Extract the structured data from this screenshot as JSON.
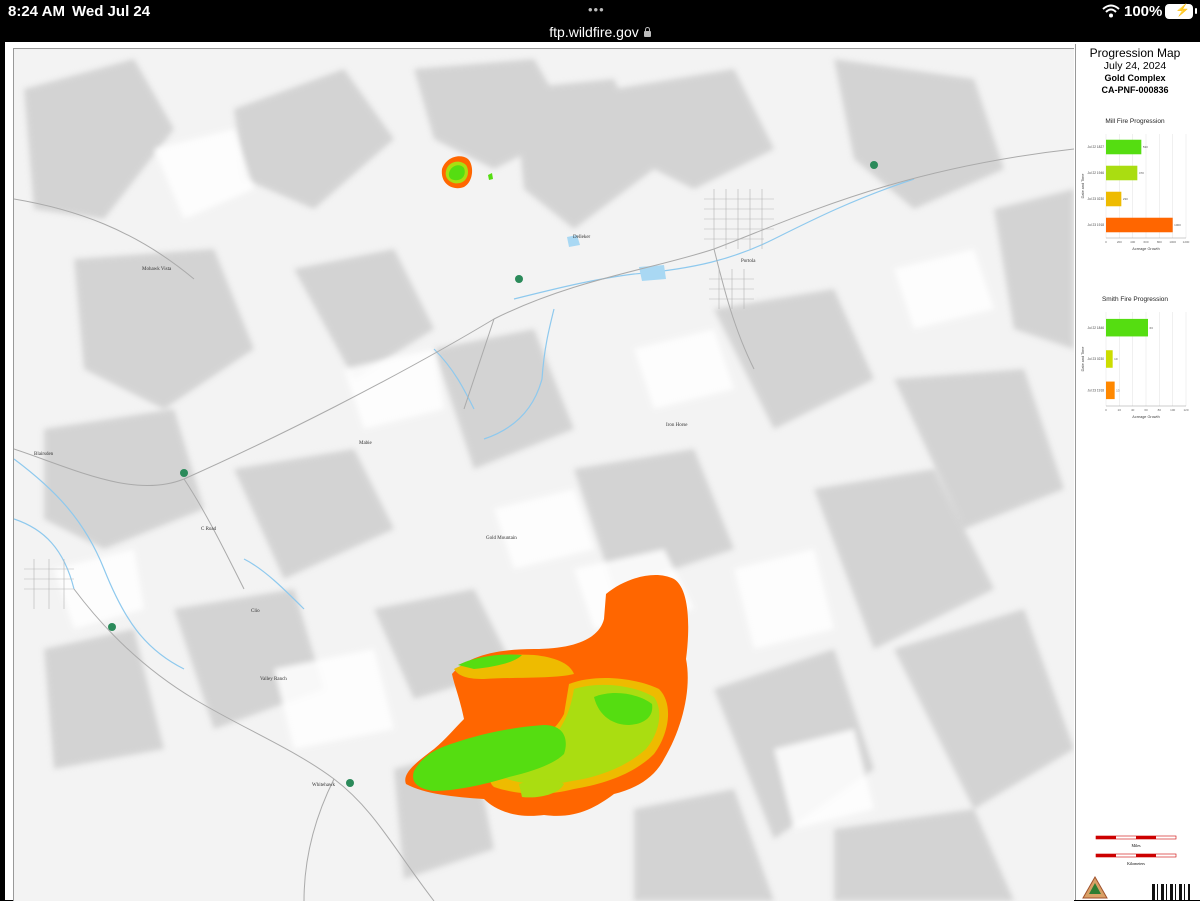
{
  "status_bar": {
    "time": "8:24 AM",
    "date": "Wed Jul 24",
    "battery": "100%",
    "tab_dots": "•••"
  },
  "browser": {
    "url": "ftp.wildfire.gov"
  },
  "legend": {
    "title": "Progression Map",
    "date": "July 24, 2024",
    "complex": "Gold Complex",
    "incident_id": "CA-PNF-000836"
  },
  "map_labels": [
    {
      "id": "dellaker",
      "text": "Delleker"
    },
    {
      "id": "portola",
      "text": "Portola"
    },
    {
      "id": "iron-horse",
      "text": "Iron Horse"
    },
    {
      "id": "mabie",
      "text": "Mabie"
    },
    {
      "id": "gold-mountain",
      "text": "Gold Mountain"
    },
    {
      "id": "valley-ranch",
      "text": "Valley Ranch"
    },
    {
      "id": "clio",
      "text": "Clio"
    },
    {
      "id": "c-road",
      "text": "C Road"
    },
    {
      "id": "blairsden",
      "text": "Blairsden"
    },
    {
      "id": "mohawk-vista",
      "text": "Mohawk Vista"
    },
    {
      "id": "whitehawk",
      "text": "Whitehawk"
    }
  ],
  "chart_data": [
    {
      "type": "bar",
      "title": "Mill Fire Progression",
      "orientation": "horizontal",
      "ylabel": "Date and Time",
      "xlabel": "Acreage Growth",
      "categories": [
        "Jul 22 1827",
        "Jul 22 1946",
        "Jul 23 0230",
        "Jul 23 1918"
      ],
      "values": [
        530,
        470,
        230,
        1000
      ],
      "colors": [
        "#55dd11",
        "#aadd11",
        "#eebb00",
        "#ff6600"
      ],
      "xlim": [
        0,
        1200
      ],
      "grid": true
    },
    {
      "type": "bar",
      "title": "Smith Fire Progression",
      "orientation": "horizontal",
      "ylabel": "Date and Time",
      "xlabel": "Acreage Growth",
      "categories": [
        "Jul 22 1846",
        "Jul 23 0230",
        "Jul 23 1918"
      ],
      "values": [
        63,
        10,
        13
      ],
      "colors": [
        "#55dd11",
        "#ccdd00",
        "#ff8800"
      ],
      "xlim": [
        0,
        120
      ],
      "grid": true
    }
  ],
  "scale": {
    "miles_label": "Miles",
    "km_label": "Kilometers"
  },
  "colors": {
    "fire_old": "#ff6600",
    "fire_mid": "#aadd11",
    "fire_new": "#55dd11",
    "fire_yellow": "#eebb00",
    "water": "#8ec9ee"
  }
}
